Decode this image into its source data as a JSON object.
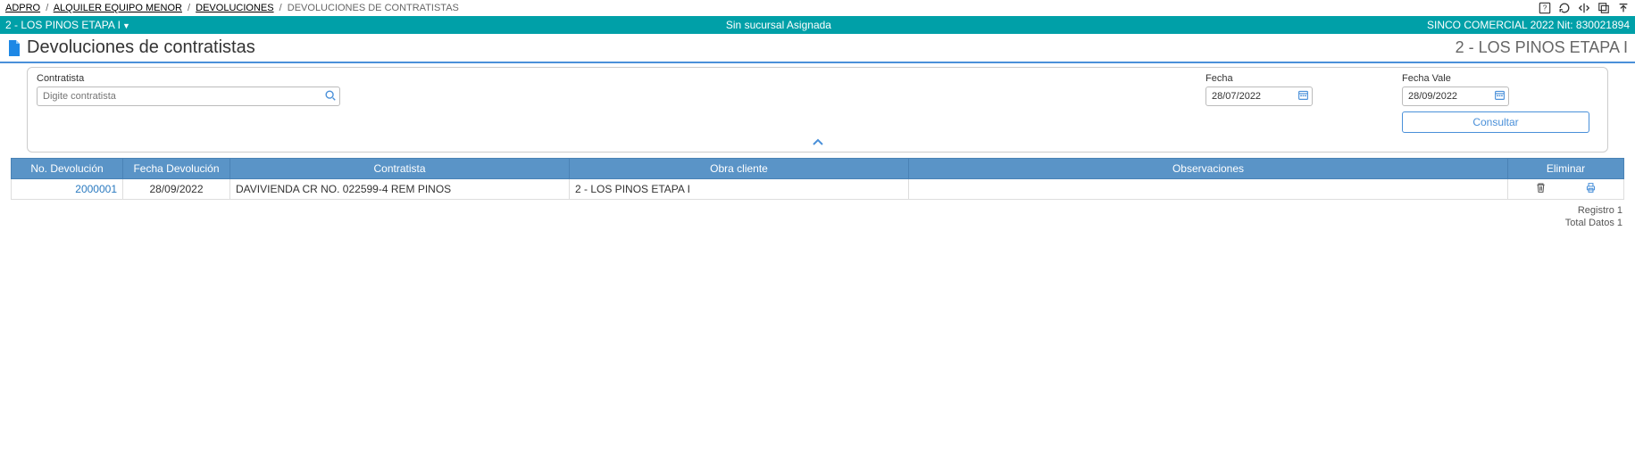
{
  "breadcrumb": {
    "items": [
      "ADPRO",
      "ALQUILER EQUIPO MENOR",
      "DEVOLUCIONES"
    ],
    "current": "DEVOLUCIONES DE CONTRATISTAS",
    "sep": "/"
  },
  "topIcons": {
    "help": "?",
    "refresh": "refresh",
    "split": "split",
    "maximize": "maximize",
    "top": "top"
  },
  "tealBar": {
    "left": "2 - LOS PINOS ETAPA I",
    "center": "Sin sucursal Asignada",
    "right": "SINCO COMERCIAL 2022 Nit: 830021894"
  },
  "title": {
    "heading": "Devoluciones de contratistas",
    "project": "2 - LOS PINOS ETAPA I"
  },
  "filters": {
    "contratista": {
      "label": "Contratista",
      "placeholder": "Digite contratista"
    },
    "fecha": {
      "label": "Fecha",
      "value": "28/07/2022"
    },
    "fechaVale": {
      "label": "Fecha Vale",
      "value": "28/09/2022"
    },
    "consultar": "Consultar"
  },
  "table": {
    "headers": {
      "no": "No. Devolución",
      "fecha": "Fecha Devolución",
      "contratista": "Contratista",
      "obra": "Obra cliente",
      "obs": "Observaciones",
      "eliminar": "Eliminar"
    },
    "rows": [
      {
        "no": "2000001",
        "fecha": "28/09/2022",
        "contratista": "DAVIVIENDA CR NO. 022599-4 REM PINOS",
        "obra": "2 - LOS PINOS ETAPA I",
        "obs": ""
      }
    ]
  },
  "footer": {
    "registro": "Registro 1",
    "total": "Total Datos 1"
  }
}
